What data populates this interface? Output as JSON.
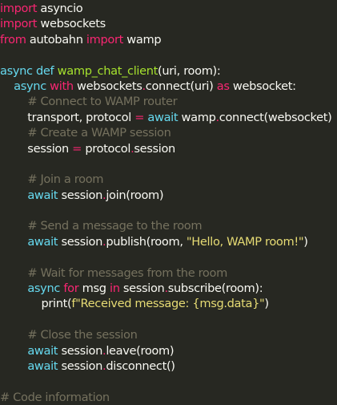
{
  "colors": {
    "background": "#272822",
    "keyword": "#f92672",
    "builtin": "#66d9ef",
    "function": "#a6e22e",
    "string": "#e6db74",
    "comment": "#75715e",
    "text": "#f8f8f2"
  },
  "code": {
    "lines": [
      [
        [
          "kw",
          "import"
        ],
        [
          "plain",
          " asyncio"
        ]
      ],
      [
        [
          "kw",
          "import"
        ],
        [
          "plain",
          " websockets"
        ]
      ],
      [
        [
          "kw",
          "from"
        ],
        [
          "plain",
          " autobahn "
        ],
        [
          "kw",
          "import"
        ],
        [
          "plain",
          " wamp"
        ]
      ],
      [],
      [
        [
          "builtin",
          "async"
        ],
        [
          "plain",
          " "
        ],
        [
          "builtin",
          "def"
        ],
        [
          "plain",
          " "
        ],
        [
          "fn",
          "wamp_chat_client"
        ],
        [
          "plain",
          "(uri, room):"
        ]
      ],
      [
        [
          "plain",
          "    "
        ],
        [
          "builtin",
          "async"
        ],
        [
          "plain",
          " "
        ],
        [
          "kw",
          "with"
        ],
        [
          "plain",
          " websockets"
        ],
        [
          "op",
          "."
        ],
        [
          "plain",
          "connect(uri) "
        ],
        [
          "kw",
          "as"
        ],
        [
          "plain",
          " websocket:"
        ]
      ],
      [
        [
          "plain",
          "        "
        ],
        [
          "comment",
          "# Connect to WAMP router"
        ]
      ],
      [
        [
          "plain",
          "        transport, protocol "
        ],
        [
          "op",
          "="
        ],
        [
          "plain",
          " "
        ],
        [
          "builtin",
          "await"
        ],
        [
          "plain",
          " wamp"
        ],
        [
          "op",
          "."
        ],
        [
          "plain",
          "connect(websocket)"
        ]
      ],
      [
        [
          "plain",
          "        "
        ],
        [
          "comment",
          "# Create a WAMP session"
        ]
      ],
      [
        [
          "plain",
          "        session "
        ],
        [
          "op",
          "="
        ],
        [
          "plain",
          " protocol"
        ],
        [
          "op",
          "."
        ],
        [
          "plain",
          "session"
        ]
      ],
      [],
      [
        [
          "plain",
          "        "
        ],
        [
          "comment",
          "# Join a room"
        ]
      ],
      [
        [
          "plain",
          "        "
        ],
        [
          "builtin",
          "await"
        ],
        [
          "plain",
          " session"
        ],
        [
          "op",
          "."
        ],
        [
          "plain",
          "join(room)"
        ]
      ],
      [],
      [
        [
          "plain",
          "        "
        ],
        [
          "comment",
          "# Send a message to the room"
        ]
      ],
      [
        [
          "plain",
          "        "
        ],
        [
          "builtin",
          "await"
        ],
        [
          "plain",
          " session"
        ],
        [
          "op",
          "."
        ],
        [
          "plain",
          "publish(room, "
        ],
        [
          "str",
          "\"Hello, WAMP room!\""
        ],
        [
          "plain",
          ")"
        ]
      ],
      [],
      [
        [
          "plain",
          "        "
        ],
        [
          "comment",
          "# Wait for messages from the room"
        ]
      ],
      [
        [
          "plain",
          "        "
        ],
        [
          "builtin",
          "async"
        ],
        [
          "plain",
          " "
        ],
        [
          "kw",
          "for"
        ],
        [
          "plain",
          " msg "
        ],
        [
          "kw",
          "in"
        ],
        [
          "plain",
          " session"
        ],
        [
          "op",
          "."
        ],
        [
          "plain",
          "subscribe(room):"
        ]
      ],
      [
        [
          "plain",
          "            print("
        ],
        [
          "str",
          "f\"Received message: {msg.data}\""
        ],
        [
          "plain",
          ")"
        ]
      ],
      [],
      [
        [
          "plain",
          "        "
        ],
        [
          "comment",
          "# Close the session"
        ]
      ],
      [
        [
          "plain",
          "        "
        ],
        [
          "builtin",
          "await"
        ],
        [
          "plain",
          " session"
        ],
        [
          "op",
          "."
        ],
        [
          "plain",
          "leave(room)"
        ]
      ],
      [
        [
          "plain",
          "        "
        ],
        [
          "builtin",
          "await"
        ],
        [
          "plain",
          " session"
        ],
        [
          "op",
          "."
        ],
        [
          "plain",
          "disconnect()"
        ]
      ],
      [],
      [
        [
          "comment",
          "# Code information"
        ]
      ]
    ]
  }
}
